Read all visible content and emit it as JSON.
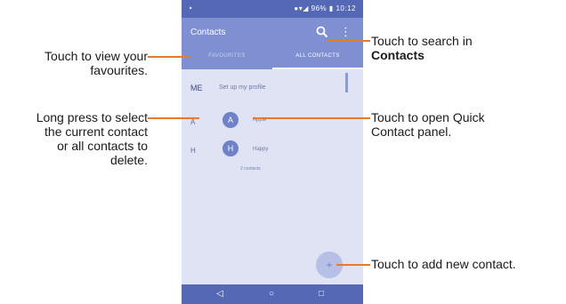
{
  "statusbar": {
    "left": "‣",
    "right": "●▾◢ 96% ▮ 10:12"
  },
  "toolbar": {
    "title": "Contacts"
  },
  "tabs": [
    {
      "label": "FAVOURITES"
    },
    {
      "label": "ALL CONTACTS"
    }
  ],
  "list": {
    "me_label": "ME",
    "me_text": "Set up my profile",
    "sections": [
      {
        "letter": "A",
        "avatar": "A",
        "name": "Apple"
      },
      {
        "letter": "H",
        "avatar": "H",
        "name": "Happy"
      }
    ],
    "count": "2 contacts"
  },
  "fab": {
    "icon": "+"
  },
  "navbar": {
    "back": "◁",
    "home": "○",
    "recents": "□"
  },
  "callouts": {
    "favourites": [
      "Touch to view your",
      "favourites."
    ],
    "long_press": [
      "Long press to select",
      "the current contact",
      "or all contacts to",
      "delete."
    ],
    "search": [
      "Touch to search in",
      "Contacts"
    ],
    "quick_contact": [
      "Touch to open Quick",
      "Contact panel."
    ],
    "add": [
      "Touch to add new contact."
    ]
  },
  "colors": {
    "accent": "#e87a30",
    "toolbar": "#7e90d2",
    "statusbar": "#5468b6"
  }
}
